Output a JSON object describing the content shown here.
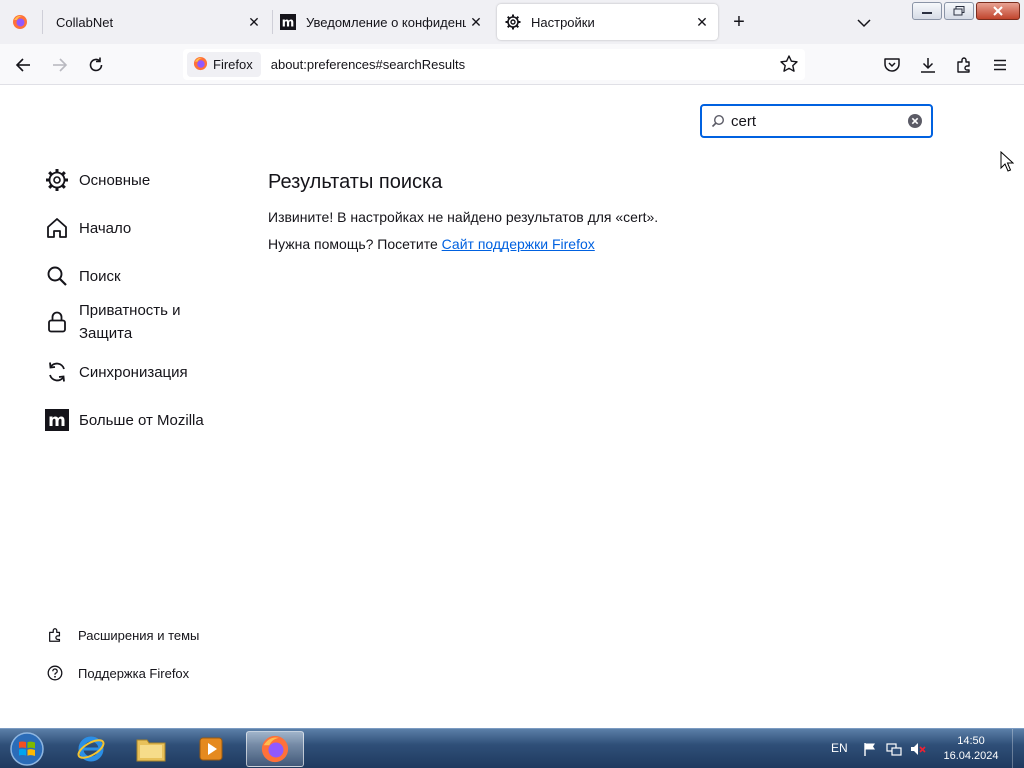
{
  "tabs": [
    {
      "title": "CollabNet",
      "favicon": "firefox-icon",
      "active": false
    },
    {
      "title": "Уведомление о конфиденциальности",
      "favicon": "mozilla-icon",
      "active": false
    },
    {
      "title": "Настройки",
      "favicon": "gear-icon",
      "active": true
    }
  ],
  "toolbar": {
    "identity_label": "Firefox",
    "url": "about:preferences#searchResults"
  },
  "search": {
    "value": "cert"
  },
  "categories": [
    {
      "label": "Основные",
      "icon": "gear-icon"
    },
    {
      "label": "Начало",
      "icon": "home-icon"
    },
    {
      "label": "Поиск",
      "icon": "search-icon"
    },
    {
      "label": "Приватность и Защита",
      "icon": "lock-icon"
    },
    {
      "label": "Синхронизация",
      "icon": "sync-icon"
    },
    {
      "label": "Больше от Mozilla",
      "icon": "mozilla-icon"
    }
  ],
  "results": {
    "title": "Результаты поиска",
    "message": "Извините! В настройках не найдено результатов для «cert».",
    "help_prefix": "Нужна помощь? Посетите ",
    "help_link": "Сайт поддержки Firefox"
  },
  "footer": {
    "extensions": "Расширения и темы",
    "support": "Поддержка Firefox"
  },
  "taskbar": {
    "language": "EN",
    "time": "14:50",
    "date": "16.04.2024"
  },
  "colors": {
    "accent": "#0061e0",
    "tabstrip": "#f0f0f4"
  }
}
